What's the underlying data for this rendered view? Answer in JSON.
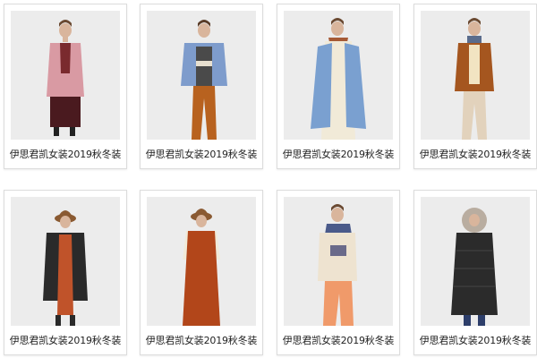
{
  "products": [
    {
      "caption": "伊思君凯女装2019秋冬装",
      "outfit": "pink-wool-coat-maroon-skirt"
    },
    {
      "caption": "伊思君凯女装2019秋冬装",
      "outfit": "blue-jacket-striped-top-rust-pants"
    },
    {
      "caption": "伊思君凯女装2019秋冬装",
      "outfit": "blue-long-vest-cream-dress"
    },
    {
      "caption": "伊思君凯女装2019秋冬装",
      "outfit": "rust-cardigan-beige-pants"
    },
    {
      "caption": "伊思君凯女装2019秋冬装",
      "outfit": "black-quilted-coat-rust-dress-hat"
    },
    {
      "caption": "伊思君凯女装2019秋冬装",
      "outfit": "rust-knit-dress-hat"
    },
    {
      "caption": "伊思君凯女装2019秋冬装",
      "outfit": "cream-sweater-orange-pants-scarf"
    },
    {
      "caption": "伊思君凯女装2019秋冬装",
      "outfit": "black-long-down-coat-fur-hood"
    }
  ]
}
